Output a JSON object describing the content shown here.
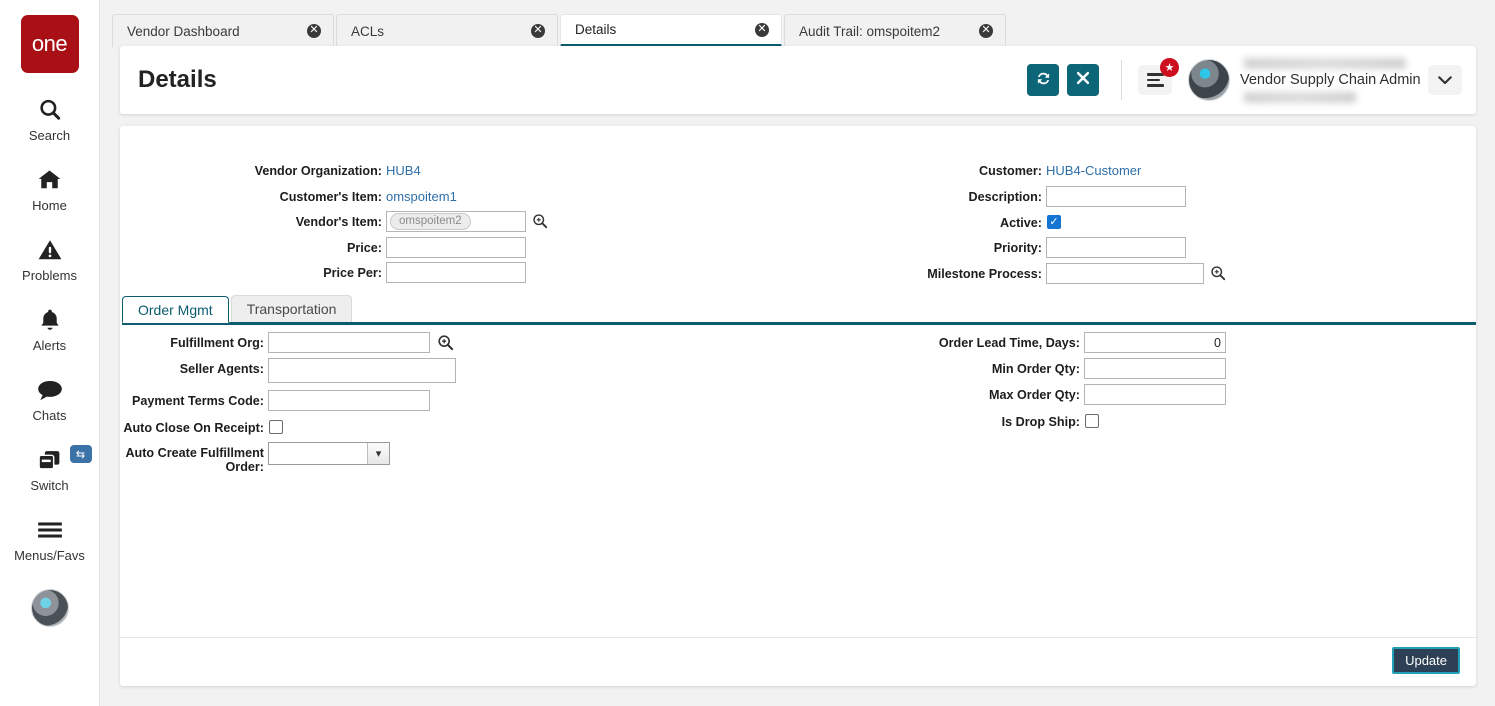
{
  "brand": {
    "logo_text": "one",
    "logo_color": "#a81016"
  },
  "sidebar": {
    "items": [
      {
        "label": "Search",
        "icon": "search-icon"
      },
      {
        "label": "Home",
        "icon": "home-icon"
      },
      {
        "label": "Problems",
        "icon": "warning-triangle-icon"
      },
      {
        "label": "Alerts",
        "icon": "bell-icon"
      },
      {
        "label": "Chats",
        "icon": "chat-bubble-icon"
      },
      {
        "label": "Switch",
        "icon": "switch-windows-icon",
        "badge_icon": "swap-arrows-icon"
      },
      {
        "label": "Menus/Favs",
        "icon": "hamburger-icon"
      }
    ],
    "avatar": "user-avatar"
  },
  "tabbar": {
    "tabs": [
      {
        "label": "Vendor Dashboard",
        "active": false
      },
      {
        "label": "ACLs",
        "active": false
      },
      {
        "label": "Details",
        "active": true
      },
      {
        "label": "Audit Trail: omspoitem2",
        "active": false
      }
    ],
    "close_glyph": "✕"
  },
  "header": {
    "title": "Details",
    "refresh_icon": "refresh-icon",
    "close_icon": "close-icon",
    "menu_favs_icon": "hamburger-icon",
    "favorites_badge_icon": "star-icon",
    "user_role": "Vendor Supply Chain Admin",
    "user_caret_icon": "chevron-down-icon",
    "accent_color": "#0c6678"
  },
  "details": {
    "left": [
      {
        "label": "Vendor Organization:",
        "type": "link",
        "value": "HUB4"
      },
      {
        "label": "Customer's Item:",
        "type": "link",
        "value": "omspoitem1"
      },
      {
        "label": "Vendor's Item:",
        "type": "chip",
        "value": "omspoitem2",
        "lookup": true
      },
      {
        "label": "Price:",
        "type": "text",
        "value": ""
      },
      {
        "label": "Price Per:",
        "type": "text",
        "value": ""
      }
    ],
    "right": [
      {
        "label": "Customer:",
        "type": "link",
        "value": "HUB4-Customer"
      },
      {
        "label": "Description:",
        "type": "text",
        "value": ""
      },
      {
        "label": "Active:",
        "type": "checkbox",
        "checked": true
      },
      {
        "label": "Priority:",
        "type": "text",
        "value": ""
      },
      {
        "label": "Milestone Process:",
        "type": "text",
        "value": "",
        "lookup": true
      }
    ]
  },
  "inner_tabs": [
    {
      "label": "Order Mgmt",
      "active": true
    },
    {
      "label": "Transportation",
      "active": false
    }
  ],
  "order_mgmt": {
    "left": [
      {
        "label": "Fulfillment Org:",
        "type": "text",
        "value": "",
        "lookup": true
      },
      {
        "label": "Seller Agents:",
        "type": "textarea",
        "value": ""
      },
      {
        "label": "Payment Terms Code:",
        "type": "text",
        "value": ""
      },
      {
        "label": "Auto Close On Receipt:",
        "type": "checkbox",
        "checked": false
      },
      {
        "label": "Auto Create Fulfillment Order:",
        "type": "select",
        "value": ""
      }
    ],
    "right": [
      {
        "label": "Order Lead Time, Days:",
        "type": "number",
        "value": "0"
      },
      {
        "label": "Min Order Qty:",
        "type": "number",
        "value": ""
      },
      {
        "label": "Max Order Qty:",
        "type": "number",
        "value": ""
      },
      {
        "label": "Is Drop Ship:",
        "type": "checkbox",
        "checked": false
      }
    ]
  },
  "footer": {
    "update_label": "Update"
  }
}
